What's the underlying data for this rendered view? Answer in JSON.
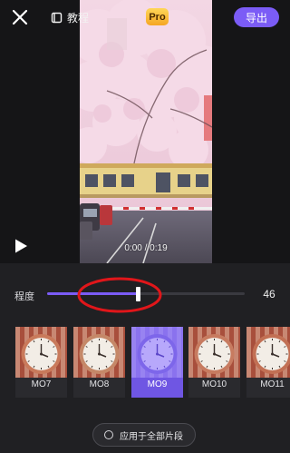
{
  "topbar": {
    "tutorial_label": "教程",
    "pro_label": "Pro",
    "export_label": "导出"
  },
  "player": {
    "current_time": "0:00",
    "duration": "0:19",
    "time_separator": " / "
  },
  "adjust": {
    "label": "程度",
    "value": "46",
    "value_fraction": 0.46
  },
  "filters": {
    "items": [
      {
        "name": "MO7",
        "active": false
      },
      {
        "name": "MO8",
        "active": false
      },
      {
        "name": "MO9",
        "active": true
      },
      {
        "name": "MO10",
        "active": false
      },
      {
        "name": "MO11",
        "active": false
      }
    ]
  },
  "apply_all_label": "应用于全部片段",
  "colors": {
    "accent": "#7b5cf6",
    "annotation": "#e0161a",
    "pro": "#f5a623"
  }
}
